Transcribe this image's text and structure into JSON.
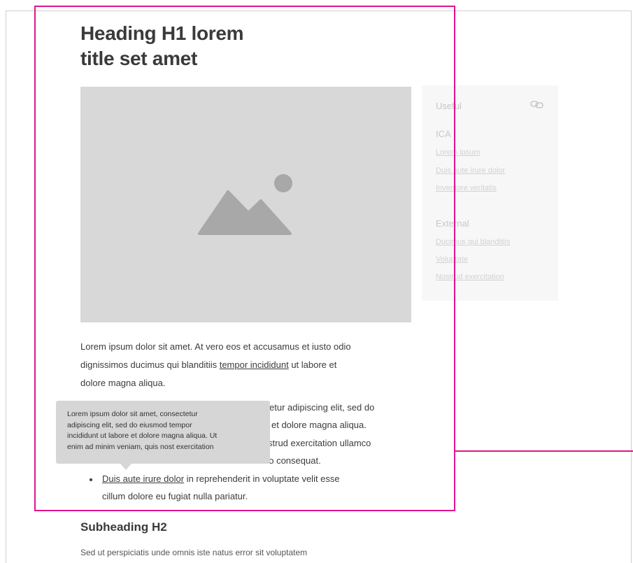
{
  "page": {
    "heading_h1": "Heading H1 lorem\ntitle set amet",
    "subheading_h2": "Subheading H2",
    "cut_off_text": "Sed ut perspiciatis unde omnis iste natus error sit voluptatem"
  },
  "sidebar": {
    "title": "Useful",
    "groups": [
      {
        "label": "ICA",
        "links": [
          "Lorem ipsum",
          "Duis aute irure dolor",
          "Inventore veritatis"
        ]
      },
      {
        "label": "External",
        "links": [
          "Ducimus qui blanditiis",
          "Voluptate",
          "Nostrud exercitation"
        ]
      }
    ]
  },
  "paragraph1": {
    "line1": "Lorem ipsum dolor sit amet.  At vero eos et accusamus et iusto odio",
    "line2_before": "dignissimos ducimus qui blanditiis ",
    "line2_link": "tempor incididunt",
    "line2_after": " ut labore et",
    "line3": "dolore magna aliqua."
  },
  "list_partial": {
    "line1": "etur adipiscing elit, sed do",
    "line2": "et dolore magna aliqua.",
    "line3": "strud exercitation ullamco",
    "line4": "do consequat.",
    "bullet_link": "Duis aute irure dolor",
    "bullet_after": " in reprehenderit in voluptate velit esse",
    "bullet_line2": "cillum dolore eu fugiat nulla pariatur."
  },
  "tooltip": {
    "lines": [
      "Lorem ipsum dolor sit amet, consectetur",
      "adipiscing elit, sed do eiusmod tempor",
      "incididunt ut labore et dolore magna aliqua. Ut",
      "enim ad minim veniam, quis nost exercitation"
    ]
  },
  "colors": {
    "selection": "#e0148c",
    "placeholder": "#d8d8d8",
    "tooltip_bg": "#d6d6d6"
  },
  "icons": {
    "hero": "image-placeholder-icon",
    "sidebar": "link-icon"
  }
}
